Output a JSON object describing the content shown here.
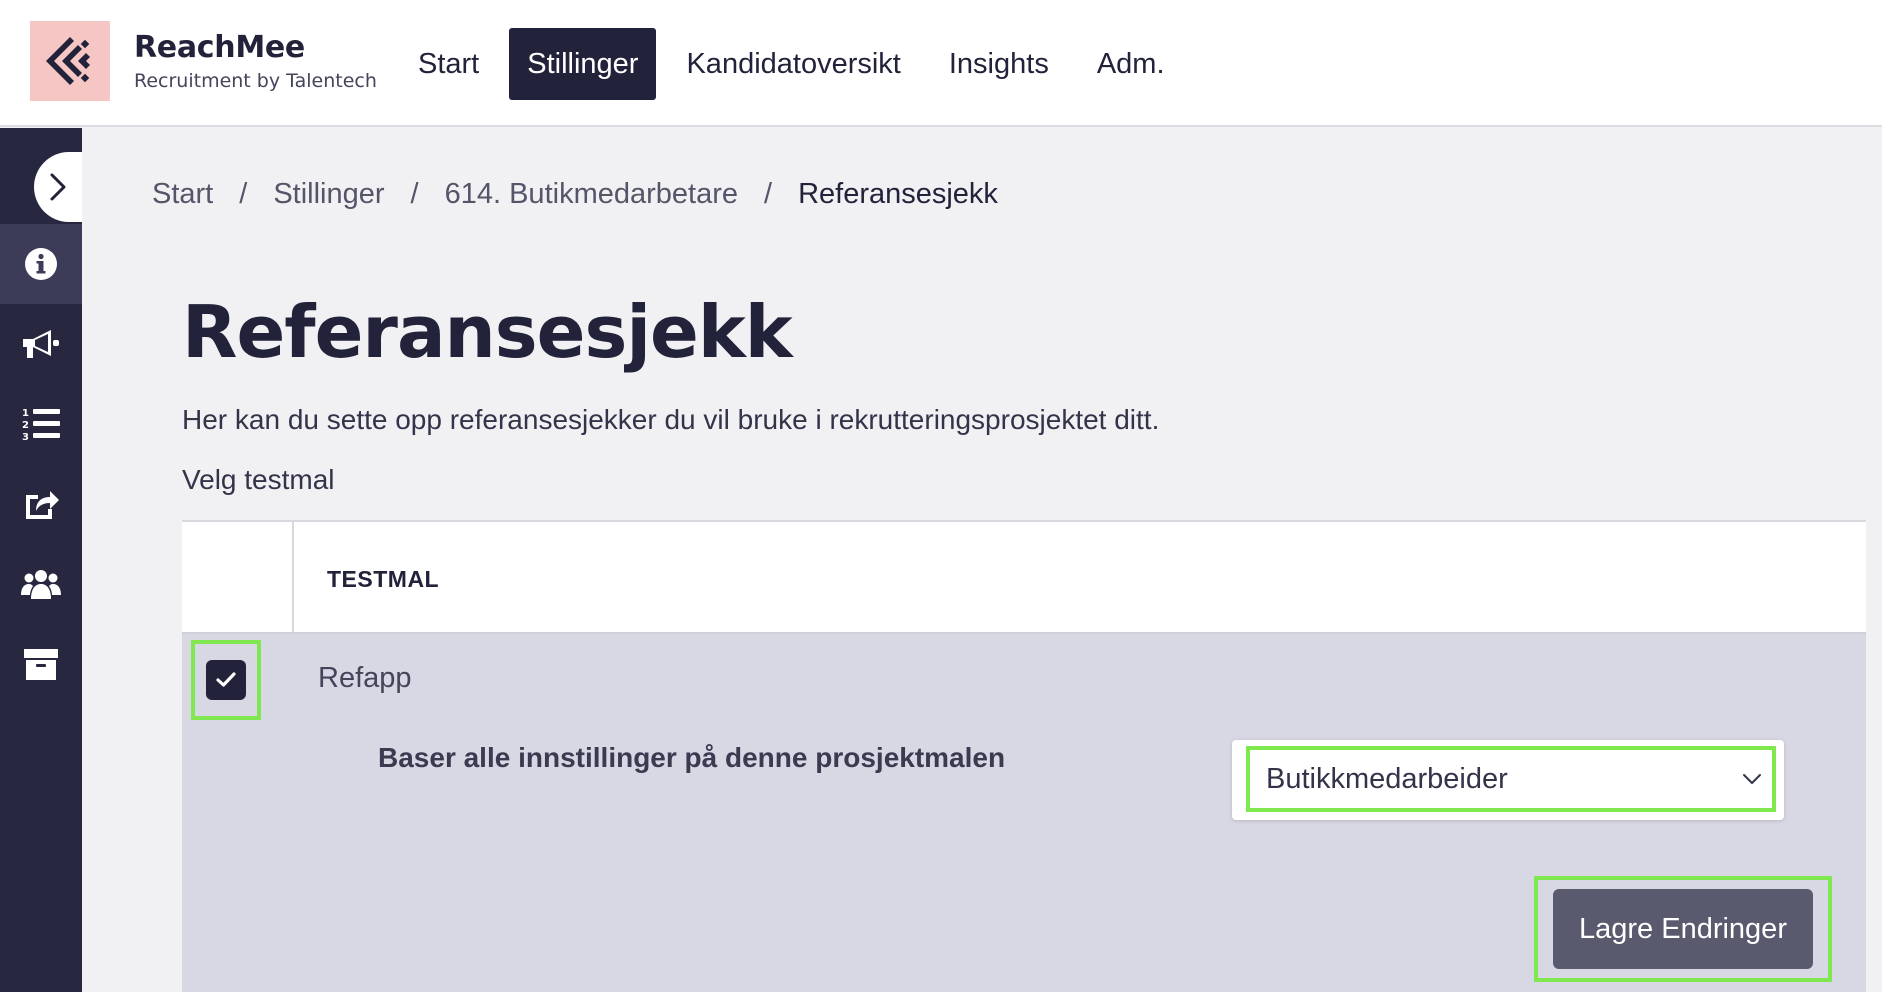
{
  "brand": {
    "name": "ReachMee",
    "subtitle": "Recruitment by Talentech",
    "logo_color": "#f5c6c3"
  },
  "nav": {
    "items": [
      {
        "label": "Start",
        "active": false
      },
      {
        "label": "Stillinger",
        "active": true
      },
      {
        "label": "Kandidatoversikt",
        "active": false
      },
      {
        "label": "Insights",
        "active": false
      },
      {
        "label": "Adm.",
        "active": false
      }
    ]
  },
  "sidebar": {
    "items": [
      {
        "icon": "info-icon",
        "active": true
      },
      {
        "icon": "megaphone-icon",
        "active": false
      },
      {
        "icon": "numbered-list-icon",
        "active": false
      },
      {
        "icon": "share-icon",
        "active": false
      },
      {
        "icon": "users-icon",
        "active": false
      },
      {
        "icon": "archive-icon",
        "active": false
      }
    ]
  },
  "breadcrumb": {
    "items": [
      "Start",
      "Stillinger",
      "614. Butikmedarbetare"
    ],
    "separator": "/",
    "current": "Referansesjekk"
  },
  "page": {
    "title": "Referansesjekk",
    "description": "Her kan du sette opp referansesjekker du vil bruke i rekrutteringsprosjektet ditt.",
    "select_label": "Velg testmal"
  },
  "table": {
    "column_header": "TESTMAL",
    "row": {
      "name": "Refapp",
      "checked": true,
      "base_label": "Baser alle innstillinger på denne prosjektmalen",
      "template_value": "Butikkmedarbeider",
      "save_label": "Lagre Endringer"
    }
  },
  "colors": {
    "dark": "#22223a",
    "sidebar": "#272740",
    "highlight": "#7fe84f",
    "row_bg": "#d8d8e4",
    "button": "#5a5a6e"
  }
}
